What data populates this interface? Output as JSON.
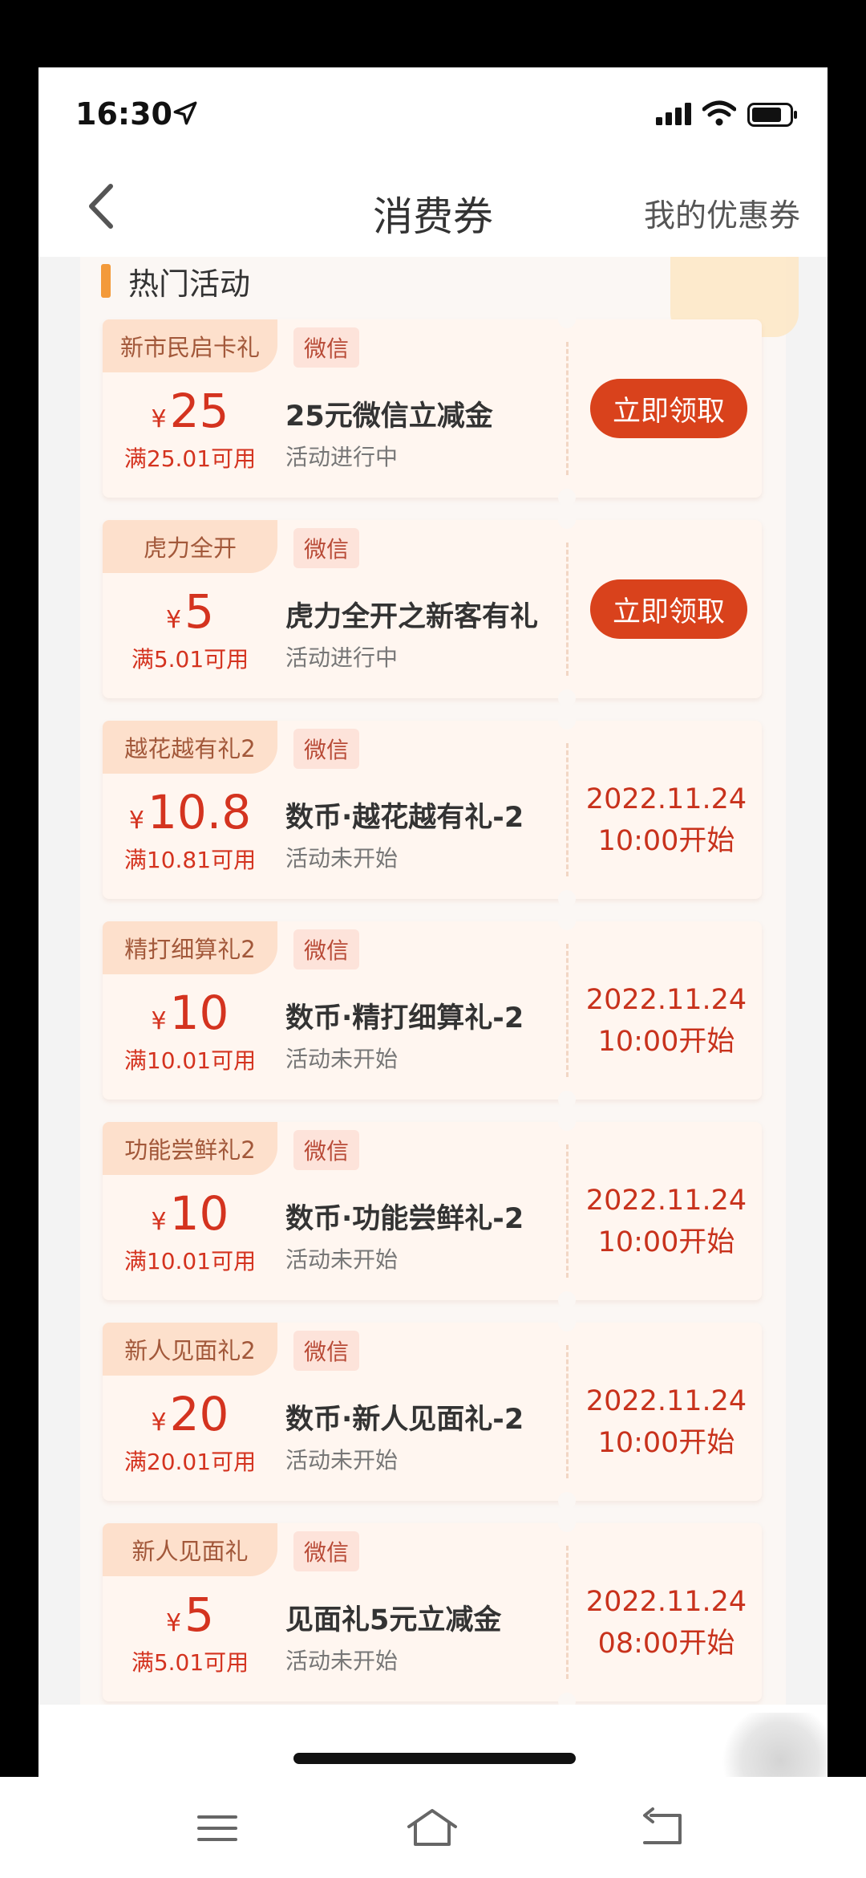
{
  "status_bar": {
    "time": "16:30"
  },
  "nav": {
    "title": "消费券",
    "right_link": "我的优惠券"
  },
  "section": {
    "title": "热门活动"
  },
  "coupons": [
    {
      "tag": "新市民启卡礼",
      "platform": "微信",
      "currency": "¥",
      "amount": "25",
      "min_spend": "满25.01可用",
      "name": "25元微信立减金",
      "status": "活动进行中",
      "action": "立即领取",
      "start_date": "",
      "start_time": ""
    },
    {
      "tag": "虎力全开",
      "platform": "微信",
      "currency": "¥",
      "amount": "5",
      "min_spend": "满5.01可用",
      "name": "虎力全开之新客有礼",
      "status": "活动进行中",
      "action": "立即领取",
      "start_date": "",
      "start_time": ""
    },
    {
      "tag": "越花越有礼2",
      "platform": "微信",
      "currency": "¥",
      "amount": "10.8",
      "min_spend": "满10.81可用",
      "name": "数币·越花越有礼-2",
      "status": "活动未开始",
      "action": "",
      "start_date": "2022.11.24",
      "start_time": "10:00开始"
    },
    {
      "tag": "精打细算礼2",
      "platform": "微信",
      "currency": "¥",
      "amount": "10",
      "min_spend": "满10.01可用",
      "name": "数币·精打细算礼-2",
      "status": "活动未开始",
      "action": "",
      "start_date": "2022.11.24",
      "start_time": "10:00开始"
    },
    {
      "tag": "功能尝鲜礼2",
      "platform": "微信",
      "currency": "¥",
      "amount": "10",
      "min_spend": "满10.01可用",
      "name": "数币·功能尝鲜礼-2",
      "status": "活动未开始",
      "action": "",
      "start_date": "2022.11.24",
      "start_time": "10:00开始"
    },
    {
      "tag": "新人见面礼2",
      "platform": "微信",
      "currency": "¥",
      "amount": "20",
      "min_spend": "满20.01可用",
      "name": "数币·新人见面礼-2",
      "status": "活动未开始",
      "action": "",
      "start_date": "2022.11.24",
      "start_time": "10:00开始"
    },
    {
      "tag": "新人见面礼",
      "platform": "微信",
      "currency": "¥",
      "amount": "5",
      "min_spend": "满5.01可用",
      "name": "见面礼5元立减金",
      "status": "活动未开始",
      "action": "",
      "start_date": "2022.11.24",
      "start_time": "08:00开始"
    }
  ],
  "colors": {
    "accent": "#d9421c",
    "price": "#d4331f",
    "section_bar": "#f39a3a",
    "tag_bg": "#fde0cc"
  },
  "icons": {
    "back": "chevron-left-icon",
    "location": "location-arrow-icon",
    "signal": "cellular-signal-icon",
    "wifi": "wifi-icon",
    "battery": "battery-icon",
    "menu": "menu-icon",
    "home": "home-icon",
    "return": "back-arrow-icon"
  }
}
